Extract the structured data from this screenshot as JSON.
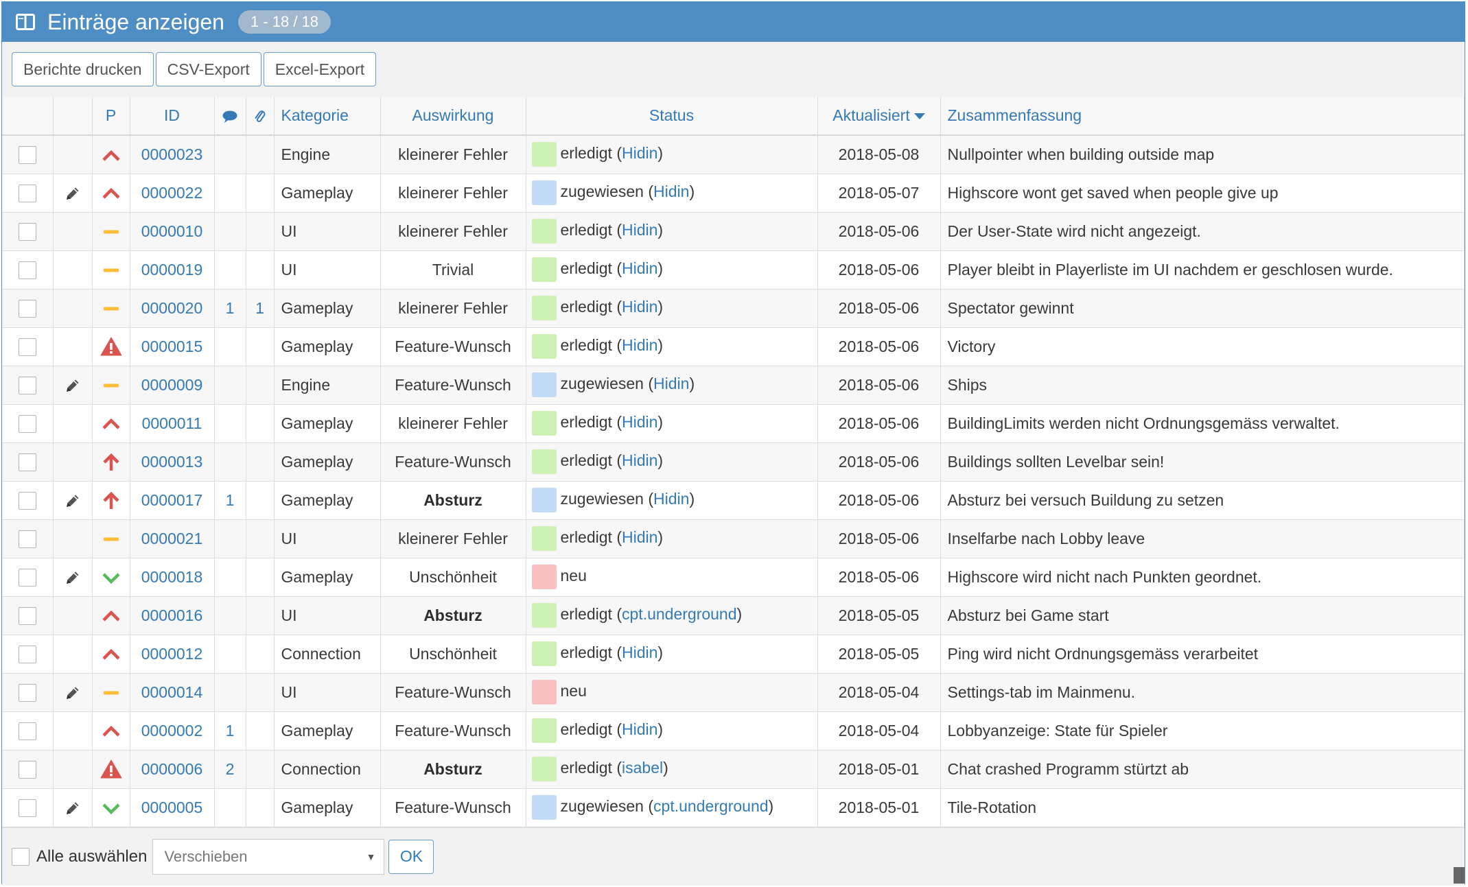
{
  "header": {
    "title": "Einträge anzeigen",
    "count": "1 - 18 / 18"
  },
  "toolbar": {
    "print": "Berichte drucken",
    "csv": "CSV-Export",
    "excel": "Excel-Export"
  },
  "columns": {
    "p": "P",
    "id": "ID",
    "category": "Kategorie",
    "severity": "Auswirkung",
    "status": "Status",
    "updated": "Aktualisiert",
    "summary": "Zusammenfassung"
  },
  "colors": {
    "erledigt": "#cdf0b4",
    "zugewiesen": "#c2dcf7",
    "neu": "#f8c0c0",
    "prio_high": "#d9534f",
    "prio_normal": "#fcbd32",
    "prio_low": "#5cb85c",
    "header": "#4e8ec5"
  },
  "rows": [
    {
      "id": "0000023",
      "edit": false,
      "prio": "high",
      "notes": "",
      "files": "",
      "category": "Engine",
      "severity": "kleinerer Fehler",
      "severity_bold": false,
      "status": "erledigt",
      "status_key": "erledigt",
      "user": "Hidin",
      "date": "2018-05-08",
      "summary": "Nullpointer when building outside map"
    },
    {
      "id": "0000022",
      "edit": true,
      "prio": "high",
      "notes": "",
      "files": "",
      "category": "Gameplay",
      "severity": "kleinerer Fehler",
      "severity_bold": false,
      "status": "zugewiesen",
      "status_key": "zugewiesen",
      "user": "Hidin",
      "date": "2018-05-07",
      "summary": "Highscore wont get saved when people give up"
    },
    {
      "id": "0000010",
      "edit": false,
      "prio": "normal",
      "notes": "",
      "files": "",
      "category": "UI",
      "severity": "kleinerer Fehler",
      "severity_bold": false,
      "status": "erledigt",
      "status_key": "erledigt",
      "user": "Hidin",
      "date": "2018-05-06",
      "summary": "Der User-State wird nicht angezeigt."
    },
    {
      "id": "0000019",
      "edit": false,
      "prio": "normal",
      "notes": "",
      "files": "",
      "category": "UI",
      "severity": "Trivial",
      "severity_bold": false,
      "status": "erledigt",
      "status_key": "erledigt",
      "user": "Hidin",
      "date": "2018-05-06",
      "summary": "Player bleibt in Playerliste im UI nachdem er geschlosen wurde."
    },
    {
      "id": "0000020",
      "edit": false,
      "prio": "normal",
      "notes": "1",
      "files": "1",
      "category": "Gameplay",
      "severity": "kleinerer Fehler",
      "severity_bold": false,
      "status": "erledigt",
      "status_key": "erledigt",
      "user": "Hidin",
      "date": "2018-05-06",
      "summary": "Spectator gewinnt"
    },
    {
      "id": "0000015",
      "edit": false,
      "prio": "immediate",
      "notes": "",
      "files": "",
      "category": "Gameplay",
      "severity": "Feature-Wunsch",
      "severity_bold": false,
      "status": "erledigt",
      "status_key": "erledigt",
      "user": "Hidin",
      "date": "2018-05-06",
      "summary": "Victory"
    },
    {
      "id": "0000009",
      "edit": true,
      "prio": "normal",
      "notes": "",
      "files": "",
      "category": "Engine",
      "severity": "Feature-Wunsch",
      "severity_bold": false,
      "status": "zugewiesen",
      "status_key": "zugewiesen",
      "user": "Hidin",
      "date": "2018-05-06",
      "summary": "Ships"
    },
    {
      "id": "0000011",
      "edit": false,
      "prio": "high",
      "notes": "",
      "files": "",
      "category": "Gameplay",
      "severity": "kleinerer Fehler",
      "severity_bold": false,
      "status": "erledigt",
      "status_key": "erledigt",
      "user": "Hidin",
      "date": "2018-05-06",
      "summary": "BuildingLimits werden nicht Ordnungsgemäss verwaltet."
    },
    {
      "id": "0000013",
      "edit": false,
      "prio": "urgent",
      "notes": "",
      "files": "",
      "category": "Gameplay",
      "severity": "Feature-Wunsch",
      "severity_bold": false,
      "status": "erledigt",
      "status_key": "erledigt",
      "user": "Hidin",
      "date": "2018-05-06",
      "summary": "Buildings sollten Levelbar sein!"
    },
    {
      "id": "0000017",
      "edit": true,
      "prio": "urgent",
      "notes": "1",
      "files": "",
      "category": "Gameplay",
      "severity": "Absturz",
      "severity_bold": true,
      "status": "zugewiesen",
      "status_key": "zugewiesen",
      "user": "Hidin",
      "date": "2018-05-06",
      "summary": "Absturz bei versuch Buildung zu setzen"
    },
    {
      "id": "0000021",
      "edit": false,
      "prio": "normal",
      "notes": "",
      "files": "",
      "category": "UI",
      "severity": "kleinerer Fehler",
      "severity_bold": false,
      "status": "erledigt",
      "status_key": "erledigt",
      "user": "Hidin",
      "date": "2018-05-06",
      "summary": "Inselfarbe nach Lobby leave"
    },
    {
      "id": "0000018",
      "edit": true,
      "prio": "low",
      "notes": "",
      "files": "",
      "category": "Gameplay",
      "severity": "Unschönheit",
      "severity_bold": false,
      "status": "neu",
      "status_key": "neu",
      "user": "",
      "date": "2018-05-06",
      "summary": "Highscore wird nicht nach Punkten geordnet."
    },
    {
      "id": "0000016",
      "edit": false,
      "prio": "high",
      "notes": "",
      "files": "",
      "category": "UI",
      "severity": "Absturz",
      "severity_bold": true,
      "status": "erledigt",
      "status_key": "erledigt",
      "user": "cpt.underground",
      "date": "2018-05-05",
      "summary": "Absturz bei Game start"
    },
    {
      "id": "0000012",
      "edit": false,
      "prio": "high",
      "notes": "",
      "files": "",
      "category": "Connection",
      "severity": "Unschönheit",
      "severity_bold": false,
      "status": "erledigt",
      "status_key": "erledigt",
      "user": "Hidin",
      "date": "2018-05-05",
      "summary": "Ping wird nicht Ordnungsgemäss verarbeitet"
    },
    {
      "id": "0000014",
      "edit": true,
      "prio": "normal",
      "notes": "",
      "files": "",
      "category": "UI",
      "severity": "Feature-Wunsch",
      "severity_bold": false,
      "status": "neu",
      "status_key": "neu",
      "user": "",
      "date": "2018-05-04",
      "summary": "Settings-tab im Mainmenu."
    },
    {
      "id": "0000002",
      "edit": false,
      "prio": "high",
      "notes": "1",
      "files": "",
      "category": "Gameplay",
      "severity": "Feature-Wunsch",
      "severity_bold": false,
      "status": "erledigt",
      "status_key": "erledigt",
      "user": "Hidin",
      "date": "2018-05-04",
      "summary": "Lobbyanzeige: State für Spieler"
    },
    {
      "id": "0000006",
      "edit": false,
      "prio": "immediate",
      "notes": "2",
      "files": "",
      "category": "Connection",
      "severity": "Absturz",
      "severity_bold": true,
      "status": "erledigt",
      "status_key": "erledigt",
      "user": "isabel",
      "date": "2018-05-01",
      "summary": "Chat crashed Programm stürtzt ab"
    },
    {
      "id": "0000005",
      "edit": true,
      "prio": "low",
      "notes": "",
      "files": "",
      "category": "Gameplay",
      "severity": "Feature-Wunsch",
      "severity_bold": false,
      "status": "zugewiesen",
      "status_key": "zugewiesen",
      "user": "cpt.underground",
      "date": "2018-05-01",
      "summary": "Tile-Rotation"
    }
  ],
  "footer": {
    "select_all": "Alle auswählen",
    "action": "Verschieben",
    "ok": "OK"
  }
}
